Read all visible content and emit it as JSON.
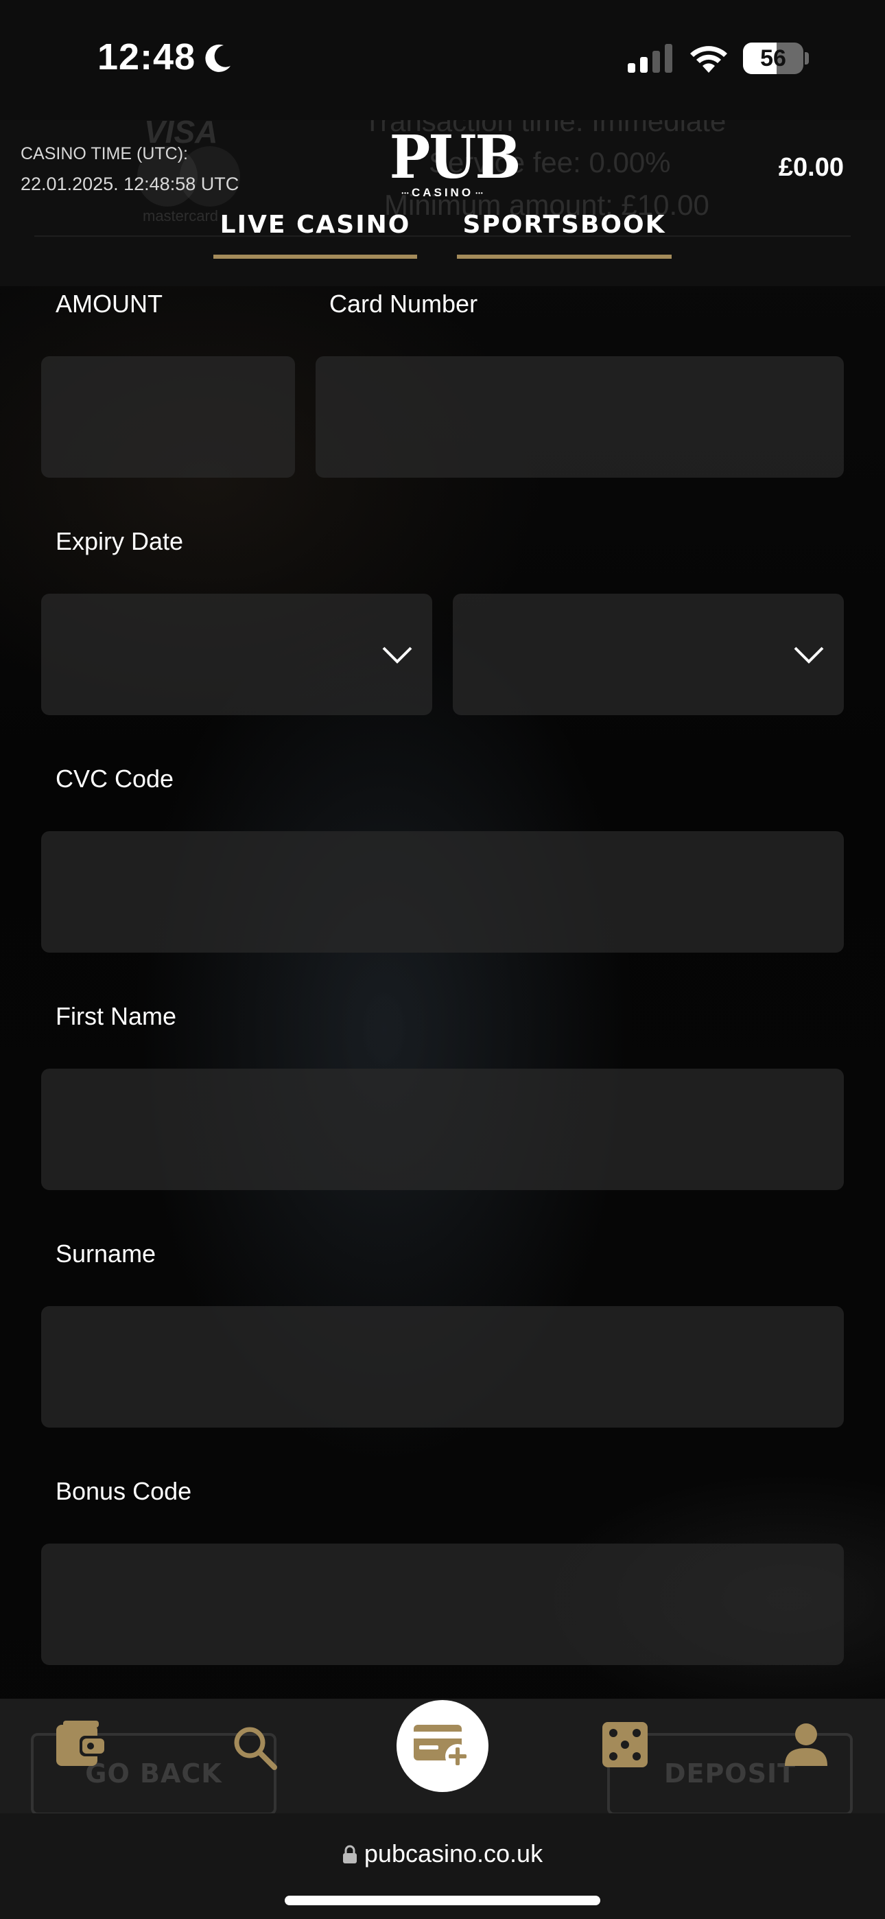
{
  "status_bar": {
    "time": "12:48",
    "battery_level": "56",
    "icons": [
      "moon-icon",
      "cellular-signal-icon",
      "wifi-icon",
      "battery-icon"
    ]
  },
  "header": {
    "casino_time_label": "CASINO TIME (UTC):",
    "casino_time_value": "22.01.2025. 12:48:58 UTC",
    "logo_main": "PUB",
    "logo_sub": "CASINO",
    "balance": "£0.00",
    "tabs": [
      {
        "label": "LIVE CASINO"
      },
      {
        "label": "SPORTSBOOK"
      }
    ],
    "ghost_content": {
      "visa": "VISA",
      "mastercard": "mastercard",
      "line1": "Transaction time: Immediate",
      "line2": "Service fee: 0.00%",
      "line3": "Minimum amount: £10.00"
    }
  },
  "form": {
    "amount_label": "AMOUNT",
    "card_number_label": "Card Number",
    "expiry_label": "Expiry Date",
    "cvc_label": "CVC Code",
    "first_name_label": "First Name",
    "surname_label": "Surname",
    "bonus_label": "Bonus Code"
  },
  "bottom_nav": {
    "ghost_go_back": "GO BACK",
    "ghost_deposit": "DEPOSIT",
    "items": [
      "wallet-icon",
      "search-icon",
      "add-card-icon",
      "dice-icon",
      "profile-icon"
    ],
    "accent_color": "#a48b5a"
  },
  "browser": {
    "url": "pubcasino.co.uk"
  }
}
